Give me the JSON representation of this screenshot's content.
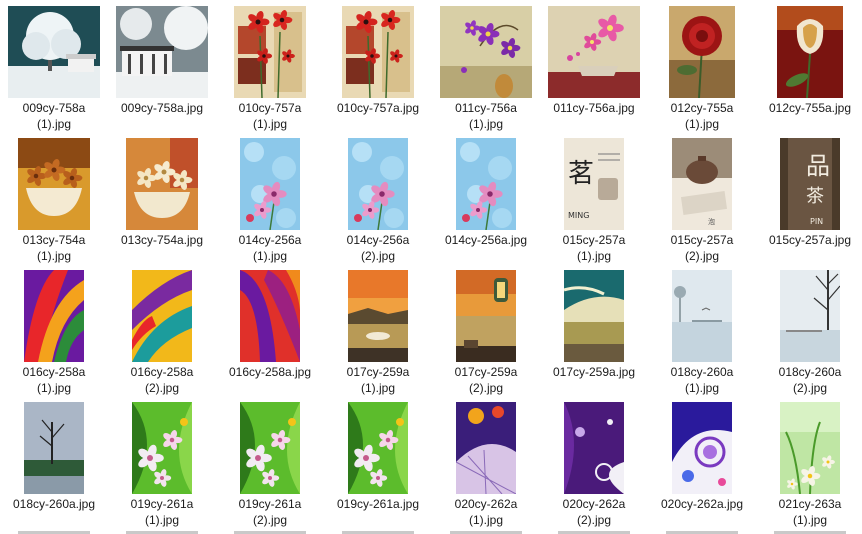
{
  "window": {
    "view": "Large icons"
  },
  "files": [
    {
      "name": "009cy-758a\n(1).jpg",
      "theme": "snow-tree",
      "shape": "wide"
    },
    {
      "name": "009cy-758a.jpg",
      "theme": "snow-house",
      "shape": "wide"
    },
    {
      "name": "010cy-757a\n(1).jpg",
      "theme": "poppies",
      "shape": "square"
    },
    {
      "name": "010cy-757a.jpg",
      "theme": "poppies",
      "shape": "square"
    },
    {
      "name": "011cy-756a\n(1).jpg",
      "theme": "orchid-purple",
      "shape": "wide"
    },
    {
      "name": "011cy-756a.jpg",
      "theme": "orchid-pink",
      "shape": "wide"
    },
    {
      "name": "012cy-755a\n(1).jpg",
      "theme": "rose-red",
      "shape": "tall"
    },
    {
      "name": "012cy-755a.jpg",
      "theme": "tulip-red",
      "shape": "tall"
    },
    {
      "name": "013cy-754a\n(1).jpg",
      "theme": "bowl-gold",
      "shape": "square"
    },
    {
      "name": "013cy-754a.jpg",
      "theme": "bowl-cream",
      "shape": "square"
    },
    {
      "name": "014cy-256a\n(1).jpg",
      "theme": "lily-blue",
      "shape": "narrow"
    },
    {
      "name": "014cy-256a\n(2).jpg",
      "theme": "lily-blue",
      "shape": "narrow"
    },
    {
      "name": "014cy-256a.jpg",
      "theme": "lily-blue",
      "shape": "narrow"
    },
    {
      "name": "015cy-257a\n(1).jpg",
      "theme": "tea-cup",
      "shape": "narrow"
    },
    {
      "name": "015cy-257a\n(2).jpg",
      "theme": "tea-pot",
      "shape": "narrow"
    },
    {
      "name": "015cy-257a.jpg",
      "theme": "tea-text",
      "shape": "narrow"
    },
    {
      "name": "016cy-258a\n(1).jpg",
      "theme": "feathers-a",
      "shape": "narrow"
    },
    {
      "name": "016cy-258a\n(2).jpg",
      "theme": "feathers-b",
      "shape": "narrow"
    },
    {
      "name": "016cy-258a.jpg",
      "theme": "feathers-c",
      "shape": "narrow"
    },
    {
      "name": "017cy-259a\n(1).jpg",
      "theme": "lake-sunset",
      "shape": "narrow"
    },
    {
      "name": "017cy-259a\n(2).jpg",
      "theme": "lake-lantern",
      "shape": "narrow"
    },
    {
      "name": "017cy-259a.jpg",
      "theme": "lake-teal",
      "shape": "narrow"
    },
    {
      "name": "018cy-260a\n(1).jpg",
      "theme": "misty-lake",
      "shape": "narrow"
    },
    {
      "name": "018cy-260a\n(2).jpg",
      "theme": "misty-tree",
      "shape": "narrow"
    },
    {
      "name": "018cy-260a.jpg",
      "theme": "dusk-tree",
      "shape": "narrow"
    },
    {
      "name": "019cy-261a\n(1).jpg",
      "theme": "green-floral",
      "shape": "narrow"
    },
    {
      "name": "019cy-261a\n(2).jpg",
      "theme": "green-floral",
      "shape": "narrow"
    },
    {
      "name": "019cy-261a.jpg",
      "theme": "green-floral",
      "shape": "narrow"
    },
    {
      "name": "020cy-262a\n(1).jpg",
      "theme": "umbrella",
      "shape": "narrow"
    },
    {
      "name": "020cy-262a\n(2).jpg",
      "theme": "purple-swirl",
      "shape": "narrow"
    },
    {
      "name": "020cy-262a.jpg",
      "theme": "purple-circles",
      "shape": "narrow"
    },
    {
      "name": "021cy-263a\n(1).jpg",
      "theme": "spring-green",
      "shape": "narrow"
    }
  ]
}
